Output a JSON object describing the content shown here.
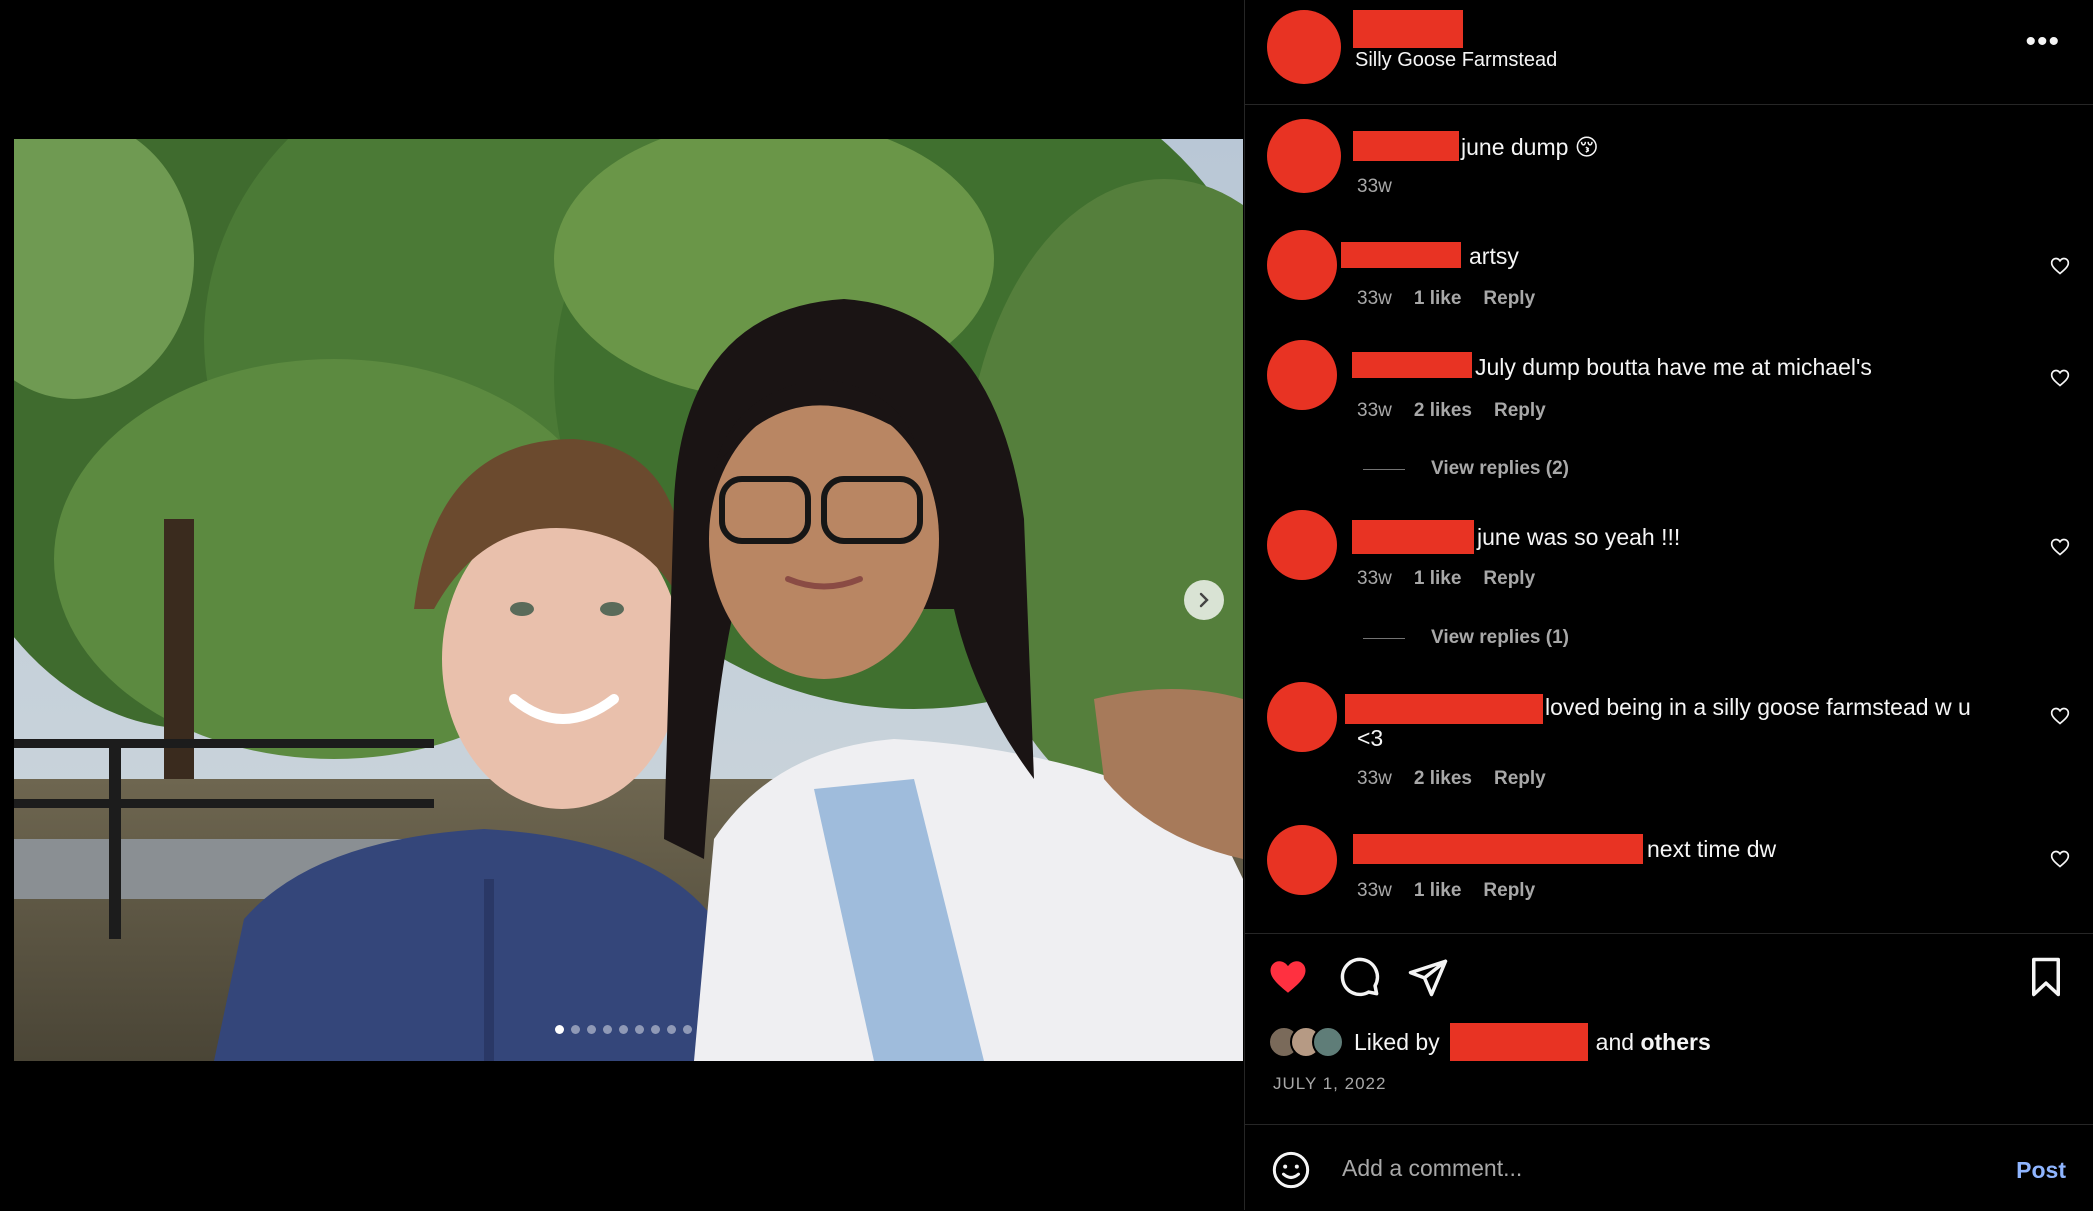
{
  "post": {
    "location": "Silly Goose Farmstead",
    "caption": "june dump 😚",
    "caption_time": "33w",
    "carousel_dots": 9,
    "carousel_active": 0
  },
  "comments": [
    {
      "text": "artsy",
      "time": "33w",
      "likes": "1 like",
      "reply": "Reply"
    },
    {
      "text": "July dump boutta have me at michael's",
      "time": "33w",
      "likes": "2 likes",
      "reply": "Reply",
      "view_replies": "View replies (2)"
    },
    {
      "text": "june was so yeah !!!",
      "time": "33w",
      "likes": "1 like",
      "reply": "Reply",
      "view_replies": "View replies (1)"
    },
    {
      "text": "loved being in a silly goose farmstead w u",
      "text_line2": "<3",
      "time": "33w",
      "likes": "2 likes",
      "reply": "Reply"
    },
    {
      "text": "next time dw",
      "time": "33w",
      "likes": "1 like",
      "reply": "Reply"
    }
  ],
  "footer": {
    "liked_by_prefix": "Liked by",
    "liked_by_and": "and",
    "liked_by_others": "others",
    "date": "JULY 1, 2022",
    "comment_placeholder": "Add a comment...",
    "post_label": "Post"
  },
  "colors": {
    "redaction": "#e83323",
    "like_heart": "#ff3040",
    "post_link": "#8fb5ff"
  },
  "icons": [
    "more-icon",
    "heart-icon",
    "comment-icon",
    "share-icon",
    "bookmark-icon",
    "emoji-icon",
    "chevron-right-icon"
  ]
}
